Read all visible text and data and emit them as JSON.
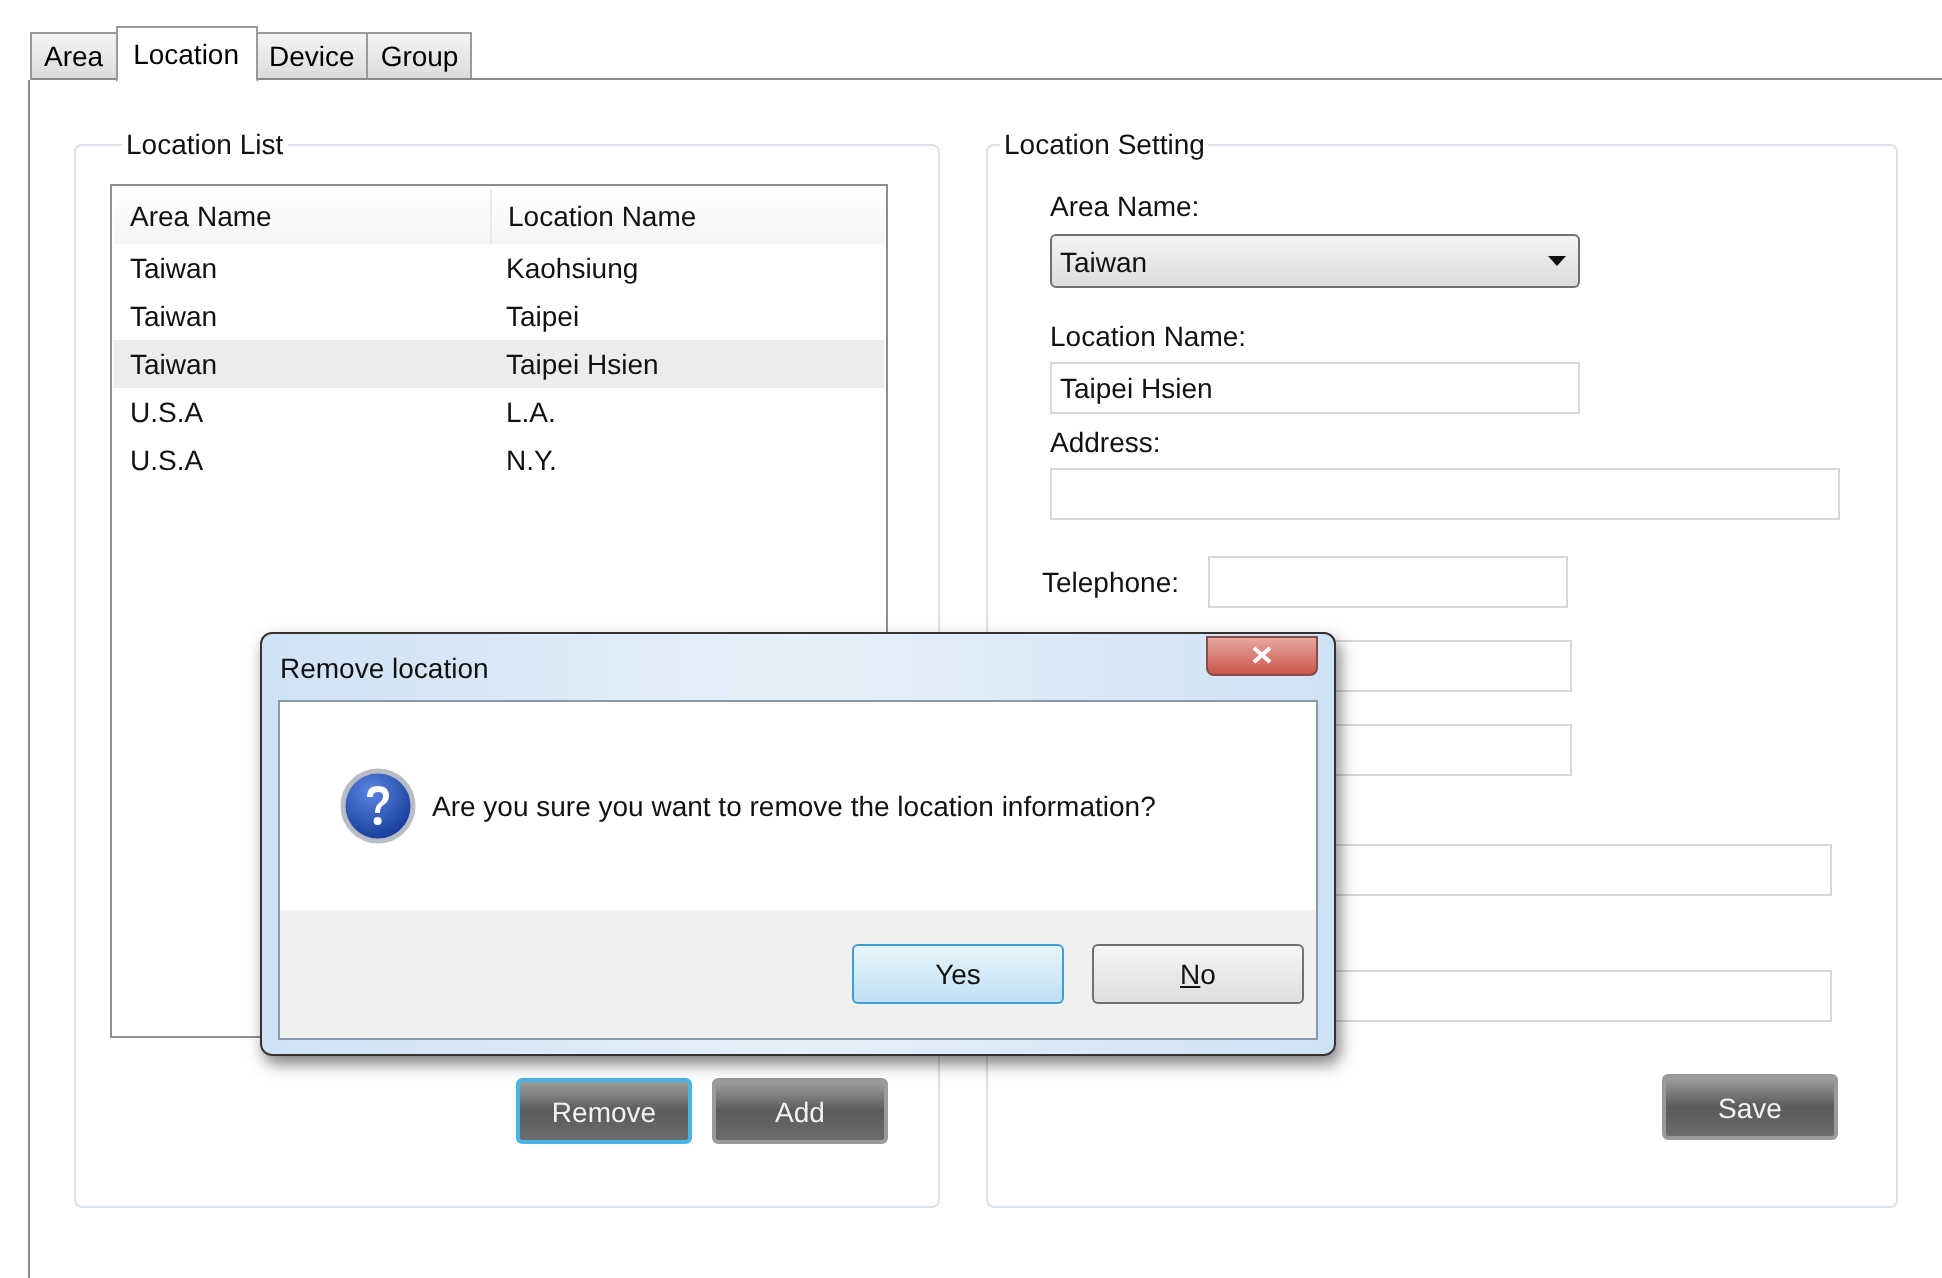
{
  "tabs": [
    {
      "label": "Area",
      "selected": false
    },
    {
      "label": "Location",
      "selected": true
    },
    {
      "label": "Device",
      "selected": false
    },
    {
      "label": "Group",
      "selected": false
    }
  ],
  "location_list": {
    "title": "Location List",
    "columns": [
      "Area Name",
      "Location Name"
    ],
    "rows": [
      {
        "cells": [
          "Taiwan",
          "Kaohsiung"
        ],
        "selected": false
      },
      {
        "cells": [
          "Taiwan",
          "Taipei"
        ],
        "selected": false
      },
      {
        "cells": [
          "Taiwan",
          "Taipei Hsien"
        ],
        "selected": true
      },
      {
        "cells": [
          "U.S.A",
          "L.A."
        ],
        "selected": false
      },
      {
        "cells": [
          "U.S.A",
          "N.Y."
        ],
        "selected": false
      }
    ],
    "buttons": [
      {
        "label": "Remove",
        "focused": true
      },
      {
        "label": "Add",
        "focused": false
      }
    ]
  },
  "location_setting": {
    "title": "Location Setting",
    "area_name": {
      "label": "Area Name:",
      "value": "Taiwan"
    },
    "location_name": {
      "label": "Location Name:",
      "value": "Taipei Hsien"
    },
    "address": {
      "label": "Address:"
    },
    "telephone": {
      "label": "Telephone:"
    },
    "other_fields": [
      {
        "kind": "short"
      },
      {
        "kind": "short"
      },
      {
        "kind": "wide"
      },
      {
        "kind": "wide"
      }
    ],
    "save_button": "Save"
  },
  "dialog": {
    "title": "Remove location",
    "message": "Are you sure you want to remove the location information?",
    "buttons": [
      {
        "label": "Yes",
        "default": true,
        "mnemonic": false
      },
      {
        "label": "No",
        "default": false,
        "mnemonic": true
      }
    ]
  }
}
